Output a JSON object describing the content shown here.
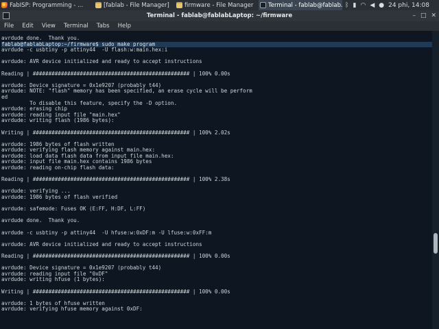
{
  "taskbar": {
    "tasks": [
      {
        "label": "FabISP: Programming - ...",
        "icon": "firefox-icon"
      },
      {
        "label": "[fablab - File Manager]",
        "icon": "folder-icon"
      },
      {
        "label": "firmware - File Manager",
        "icon": "folder-icon"
      },
      {
        "label": "Terminal - fablab@fablab...",
        "icon": "terminal-icon"
      }
    ],
    "clock": "24 phi, 14:08"
  },
  "window": {
    "title": "Terminal - fablab@fablabLaptop: ~/firmware"
  },
  "menu": {
    "items": [
      "File",
      "Edit",
      "View",
      "Terminal",
      "Tabs",
      "Help"
    ]
  },
  "terminal": {
    "before": "avrdude done.  Thank you.\n",
    "command": "fablab@fablabLaptop:~/firmware$ sudo make program",
    "after": "avrdude -c usbtiny -p attiny44  -U flash:w:main.hex:i\n\navrdude: AVR device initialized and ready to accept instructions\n\nReading | ################################################## | 100% 0.00s\n\navrdude: Device signature = 0x1e9207 (probably t44)\navrdude: NOTE: \"flash\" memory has been specified, an erase cycle will be perform\ned\n         To disable this feature, specify the -D option.\navrdude: erasing chip\navrdude: reading input file \"main.hex\"\navrdude: writing flash (1986 bytes):\n\nWriting | ################################################## | 100% 2.02s\n\navrdude: 1986 bytes of flash written\navrdude: verifying flash memory against main.hex:\navrdude: load data flash data from input file main.hex:\navrdude: input file main.hex contains 1986 bytes\navrdude: reading on-chip flash data:\n\nReading | ################################################## | 100% 2.38s\n\navrdude: verifying ...\navrdude: 1986 bytes of flash verified\n\navrdude: safemode: Fuses OK (E:FF, H:DF, L:FF)\n\navrdude done.  Thank you.\n\navrdude -c usbtiny -p attiny44  -U hfuse:w:0xDF:m -U lfuse:w:0xFF:m\n\navrdude: AVR device initialized and ready to accept instructions\n\nReading | ################################################## | 100% 0.00s\n\navrdude: Device signature = 0x1e9207 (probably t44)\navrdude: reading input file \"0xDF\"\navrdude: writing hfuse (1 bytes):\n\nWriting | ################################################## | 100% 0.00s\n\navrdude: 1 bytes of hfuse written\navrdude: verifying hfuse memory against 0xDF:"
  }
}
